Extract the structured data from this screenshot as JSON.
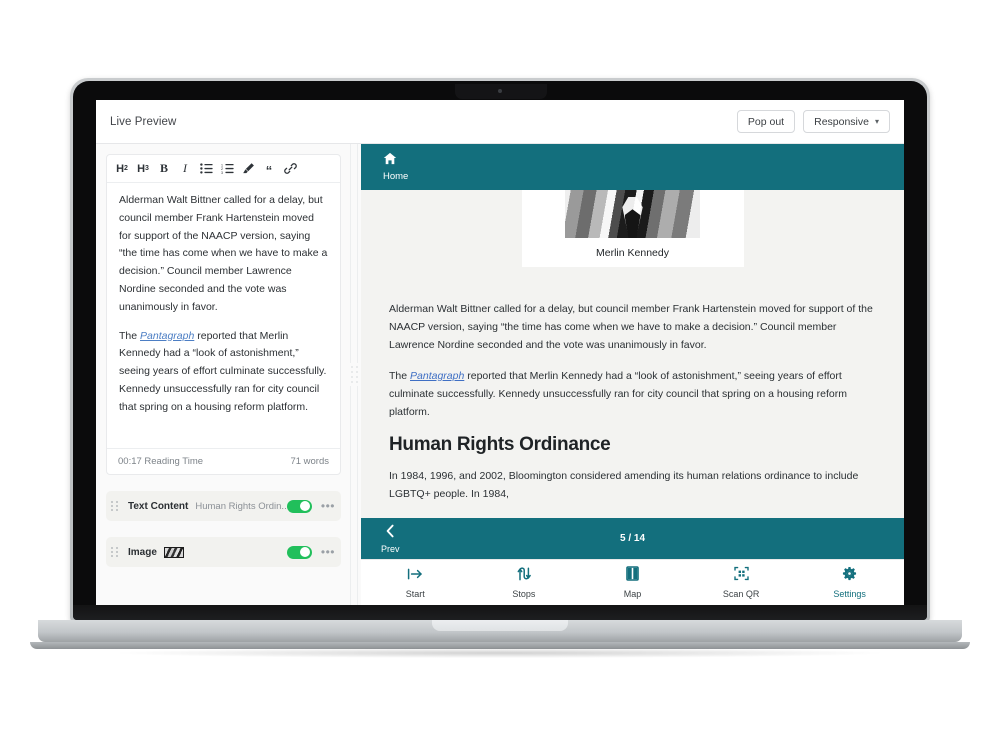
{
  "app": {
    "title": "Live Preview",
    "pop_out_label": "Pop out",
    "responsive_label": "Responsive",
    "chevron": "▾"
  },
  "editor": {
    "toolbar": [
      {
        "name": "heading-2-button",
        "label": "H2"
      },
      {
        "name": "heading-3-button",
        "label": "H3"
      },
      {
        "name": "bold-button",
        "label": "B"
      },
      {
        "name": "italic-button",
        "label": "I"
      },
      {
        "name": "bullet-list-button",
        "label": ""
      },
      {
        "name": "numbered-list-button",
        "label": ""
      },
      {
        "name": "highlight-button",
        "label": ""
      },
      {
        "name": "blockquote-button",
        "label": "“"
      },
      {
        "name": "link-button",
        "label": ""
      }
    ],
    "paragraph_1": "Alderman Walt Bittner called for a delay, but council member Frank Hartenstein moved for support of the NAACP version, saying “the time has come when we have to make a decision.” Council member Lawrence Nordine seconded and the vote was unanimously in favor.",
    "paragraph_2_before": "The ",
    "paragraph_2_link": "Pantagraph",
    "paragraph_2_after": " reported that Merlin Kennedy had a “look of astonishment,” seeing years of effort culminate successfully. Kennedy unsuccessfully ran for city council that spring on a housing reform platform.",
    "reading_time": "00:17 Reading Time",
    "word_count": "71 words"
  },
  "blocks": [
    {
      "name": "block-text-content",
      "label": "Text Content",
      "subtitle": "Human Rights Ordin...",
      "has_thumbnail": false,
      "toggle_on": true,
      "menu": "•••"
    },
    {
      "name": "block-image",
      "label": "Image",
      "subtitle": "",
      "has_thumbnail": true,
      "toggle_on": true,
      "menu": "•••"
    }
  ],
  "preview": {
    "home_label": "Home",
    "photo_caption": "Merlin Kennedy",
    "paragraph_1": "Alderman Walt Bittner called for a delay, but council member Frank Hartenstein moved for support of the NAACP version, saying “the time has come when we have to make a decision.” Council member Lawrence Nordine seconded and the vote was unanimously in favor.",
    "paragraph_2_before": "The ",
    "paragraph_2_link": "Pantagraph",
    "paragraph_2_after": " reported that Merlin Kennedy had a “look of astonishment,” seeing years of effort culminate successfully. Kennedy unsuccessfully ran for city council that spring on a housing reform platform.",
    "heading": "Human Rights Ordinance",
    "paragraph_3": "In 1984, 1996, and 2002, Bloomington considered amending its human relations ordinance to include LGBTQ+ people. In 1984,",
    "prev_label": "Prev",
    "page_counter": "5 / 14",
    "tabs": [
      {
        "name": "tab-start",
        "label": "Start",
        "icon": "start-icon"
      },
      {
        "name": "tab-stops",
        "label": "Stops",
        "icon": "stops-icon"
      },
      {
        "name": "tab-map",
        "label": "Map",
        "icon": "map-icon"
      },
      {
        "name": "tab-scan-qr",
        "label": "Scan QR",
        "icon": "qr-icon"
      },
      {
        "name": "tab-settings",
        "label": "Settings",
        "icon": "gear-icon"
      }
    ]
  },
  "colors": {
    "teal": "#136f7d",
    "toggle_green": "#21bf5b",
    "link_blue": "#3f6fc4"
  }
}
